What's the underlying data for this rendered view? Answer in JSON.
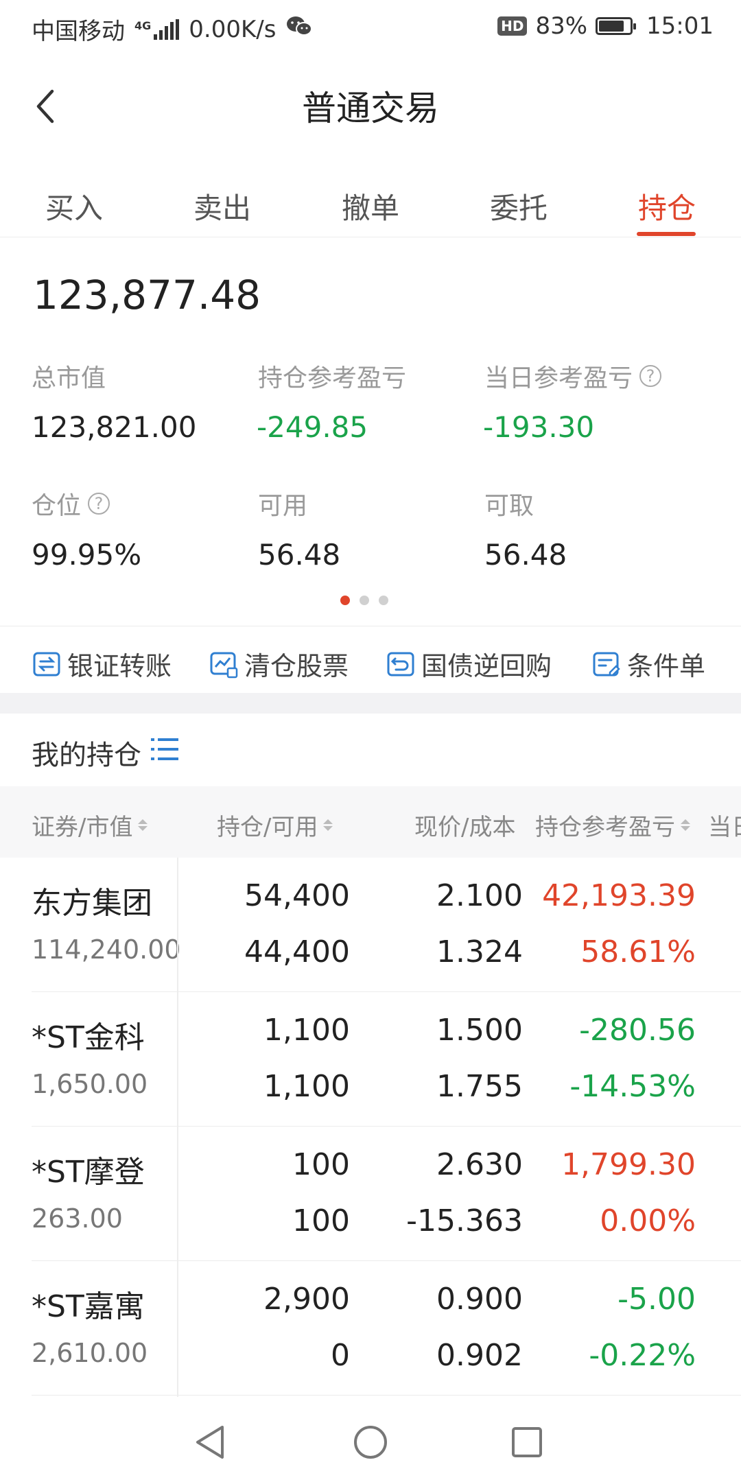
{
  "status_bar": {
    "carrier": "中国移动",
    "network": "4G",
    "speed": "0.00K/s",
    "hd": "HD",
    "battery": "83%",
    "battery_level": 0.83,
    "time": "15:01"
  },
  "header": {
    "title": "普通交易"
  },
  "tabs": [
    {
      "label": "买入",
      "active": false
    },
    {
      "label": "卖出",
      "active": false
    },
    {
      "label": "撤单",
      "active": false
    },
    {
      "label": "委托",
      "active": false
    },
    {
      "label": "持仓",
      "active": true
    }
  ],
  "summary": {
    "total_assets": "123,877.48",
    "market_value_label": "总市值",
    "market_value": "123,821.00",
    "position_pl_label": "持仓参考盈亏",
    "position_pl": "-249.85",
    "day_pl_label": "当日参考盈亏",
    "day_pl": "-193.30",
    "position_ratio_label": "仓位",
    "position_ratio": "99.95%",
    "available_label": "可用",
    "available": "56.48",
    "withdrawable_label": "可取",
    "withdrawable": "56.48",
    "help_glyph": "?"
  },
  "quick_actions": [
    {
      "label": "银证转账",
      "icon": "bank-transfer-icon"
    },
    {
      "label": "清仓股票",
      "icon": "clear-stock-icon"
    },
    {
      "label": "国债逆回购",
      "icon": "reverse-repo-icon"
    },
    {
      "label": "条件单",
      "icon": "conditional-order-icon"
    }
  ],
  "holdings_title": "我的持仓",
  "table": {
    "headers": [
      "证券/市值",
      "持仓/可用",
      "现价/成本",
      "持仓参考盈亏",
      "当日"
    ],
    "rows": [
      {
        "name": "东方集团",
        "market_value": "114,240.00",
        "position": "54,400",
        "available": "44,400",
        "price": "2.100",
        "cost": "1.324",
        "pl": "42,193.39",
        "pl_pct": "58.61%",
        "trend": "up"
      },
      {
        "name": "*ST金科",
        "market_value": "1,650.00",
        "position": "1,100",
        "available": "1,100",
        "price": "1.500",
        "cost": "1.755",
        "pl": "-280.56",
        "pl_pct": "-14.53%",
        "trend": "down"
      },
      {
        "name": "*ST摩登",
        "market_value": "263.00",
        "position": "100",
        "available": "100",
        "price": "2.630",
        "cost": "-15.363",
        "pl": "1,799.30",
        "pl_pct": "0.00%",
        "trend": "up"
      },
      {
        "name": "*ST嘉寓",
        "market_value": "2,610.00",
        "position": "2,900",
        "available": "0",
        "price": "0.900",
        "cost": "0.902",
        "pl": "-5.00",
        "pl_pct": "-0.22%",
        "trend": "down"
      }
    ]
  },
  "colors": {
    "accent": "#e0452b",
    "gain": "#e0452b",
    "loss": "#1aa34a",
    "icon_blue": "#2f7fd1"
  }
}
